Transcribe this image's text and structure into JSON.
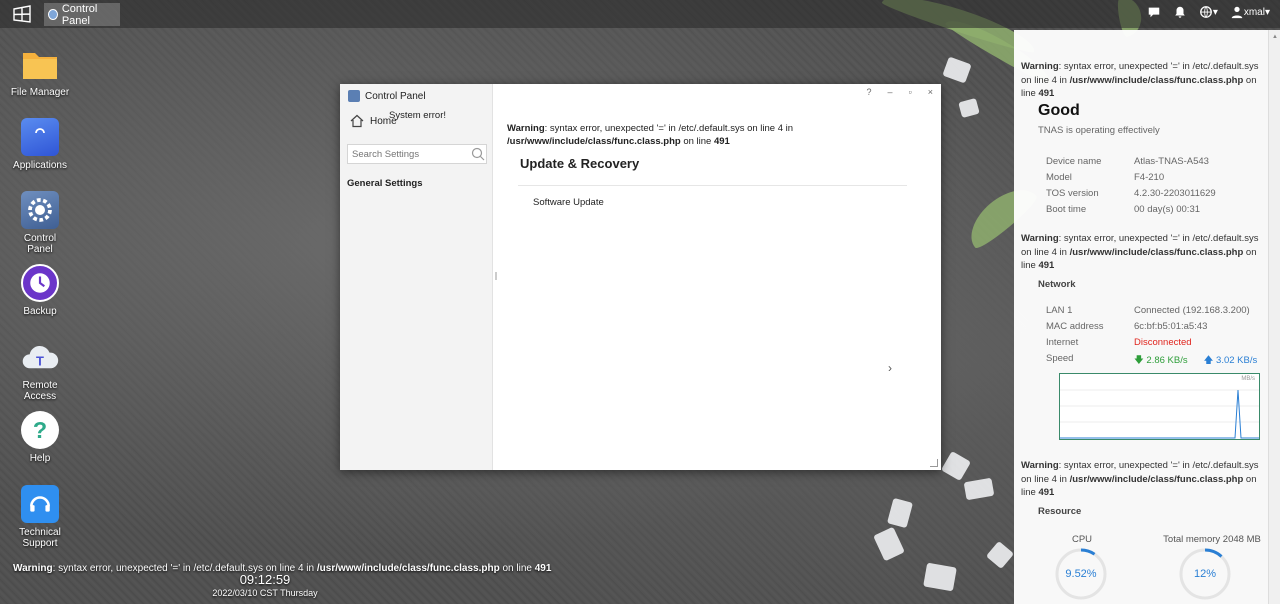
{
  "taskbar": {
    "active_task": "Control Panel",
    "user": "xmal"
  },
  "desktop_icons": [
    {
      "label": "File Manager",
      "icon": "folder-icon"
    },
    {
      "label": "Applications",
      "icon": "shopping-bag-icon"
    },
    {
      "label": "Control Panel",
      "icon": "gear-icon"
    },
    {
      "label": "Backup",
      "icon": "clock-icon"
    },
    {
      "label": "Remote Access",
      "icon": "cloud-icon"
    },
    {
      "label": "Help",
      "icon": "question-icon"
    },
    {
      "label": "Technical Support",
      "icon": "headset-icon"
    }
  ],
  "desktop_warning": {
    "prefix": "Warning",
    "text": ": syntax error, unexpected '=' in /etc/.default.sys on line 4 in ",
    "path": "/usr/www/include/class/func.class.php",
    "mid": " on line ",
    "line": "491"
  },
  "clock": {
    "time": "09:12:59",
    "date": "2022/03/10 CST Thursday"
  },
  "window": {
    "title": "Control Panel",
    "home_label": "Home",
    "system_error": "System error!",
    "search_placeholder": "Search Settings",
    "side_section": "General Settings",
    "controls": [
      "?",
      "–",
      "▫",
      "×"
    ],
    "warning": {
      "prefix": "Warning",
      "text": ": syntax error, unexpected '=' in /etc/.default.sys on line 4 in ",
      "path": "/usr/www/include/class/func.class.php",
      "mid": " on line ",
      "line": "491"
    },
    "heading": "Update & Recovery",
    "item": "Software Update"
  },
  "panel": {
    "warning": {
      "prefix": "Warning",
      "text": ": syntax error, unexpected '=' in /etc/.default.sys on line 4 in ",
      "path": "/usr/www/include/class/func.class.php",
      "mid": " on line ",
      "line": "491"
    },
    "status_title": "Good",
    "status_sub": "TNAS is operating effectively",
    "device": [
      {
        "key": "Device name",
        "value": "Atlas-TNAS-A543"
      },
      {
        "key": "Model",
        "value": "F4-210"
      },
      {
        "key": "TOS version",
        "value": "4.2.30-2203011629"
      },
      {
        "key": "Boot time",
        "value": "00 day(s) 00:31"
      }
    ],
    "network_title": "Network",
    "network": [
      {
        "key": "LAN 1",
        "value": "Connected (192.168.3.200)"
      },
      {
        "key": "MAC address",
        "value": "6c:bf:b5:01:a5:43"
      },
      {
        "key": "Internet",
        "value": "Disconnected"
      }
    ],
    "speed_label": "Speed",
    "speed_down": "2.86 KB/s",
    "speed_up": "3.02 KB/s",
    "chart_unit": "MB/s",
    "resource_title": "Resource",
    "cpu_label": "CPU",
    "cpu_value": "9.52%",
    "cpu_fraction": 0.0952,
    "mem_label": "Total memory 2048 MB",
    "mem_value": "12%",
    "mem_fraction": 0.12
  },
  "colors": {
    "accent": "#2a7fd4",
    "error": "#e0241d",
    "download": "#2e9e3a"
  }
}
